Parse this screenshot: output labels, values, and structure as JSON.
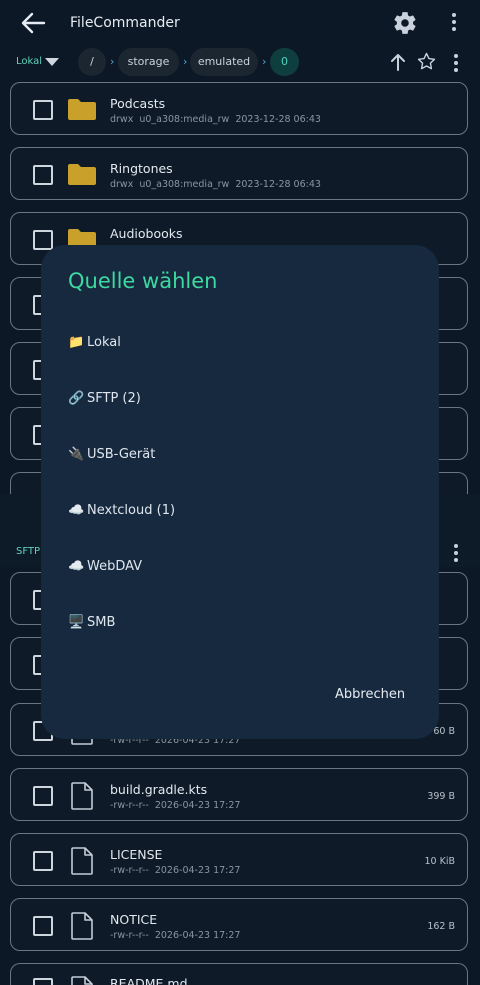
{
  "app": {
    "title": "FileCommander"
  },
  "local": {
    "source_label": "Lokal",
    "breadcrumbs": [
      {
        "label": "/",
        "active": false
      },
      {
        "label": "storage",
        "active": false
      },
      {
        "label": "emulated",
        "active": false
      },
      {
        "label": "0",
        "active": true
      }
    ],
    "separator": "›",
    "items": [
      {
        "name": "Podcasts",
        "type": "folder",
        "perms": "drwx",
        "owner": "u0_a308:media_rw",
        "date": "2023-12-28 06:43"
      },
      {
        "name": "Ringtones",
        "type": "folder",
        "perms": "drwx",
        "owner": "u0_a308:media_rw",
        "date": "2023-12-28 06:43"
      },
      {
        "name": "Audiobooks",
        "type": "folder"
      }
    ]
  },
  "remote": {
    "source_label": "SFTP",
    "items": [
      {
        "type": "file",
        "size": "60 B",
        "perms": "-rw-r--r--",
        "date": "2026-04-23 17:27"
      },
      {
        "name": "build.gradle.kts",
        "type": "file",
        "perms": "-rw-r--r--",
        "date": "2026-04-23 17:27",
        "size": "399 B"
      },
      {
        "name": "LICENSE",
        "type": "file",
        "perms": "-rw-r--r--",
        "date": "2026-04-23 17:27",
        "size": "10 KiB"
      },
      {
        "name": "NOTICE",
        "type": "file",
        "perms": "-rw-r--r--",
        "date": "2026-04-23 17:27",
        "size": "162 B"
      },
      {
        "name": "README.md",
        "type": "file"
      }
    ]
  },
  "dialog": {
    "title": "Quelle wählen",
    "options": [
      {
        "icon": "📁",
        "label": "Lokal"
      },
      {
        "icon": "🔗",
        "label": "SFTP (2)"
      },
      {
        "icon": "🔌",
        "label": "USB-Gerät"
      },
      {
        "icon": "☁️",
        "label": "Nextcloud (1)"
      },
      {
        "icon": "☁️",
        "label": "WebDAV"
      },
      {
        "icon": "🖥️",
        "label": "SMB"
      }
    ],
    "cancel_label": "Abbrechen"
  },
  "colors": {
    "accent": "#3ed9a0",
    "teal": "#5fd3b8",
    "folder": "#c9a02a",
    "background": "#0c1826",
    "dialog": "#17293f"
  },
  "icons": [
    "back-arrow-icon",
    "gear-icon",
    "more-vert-icon",
    "dropdown-arrow-icon",
    "arrow-up-icon",
    "star-icon",
    "folder-icon",
    "file-icon"
  ]
}
